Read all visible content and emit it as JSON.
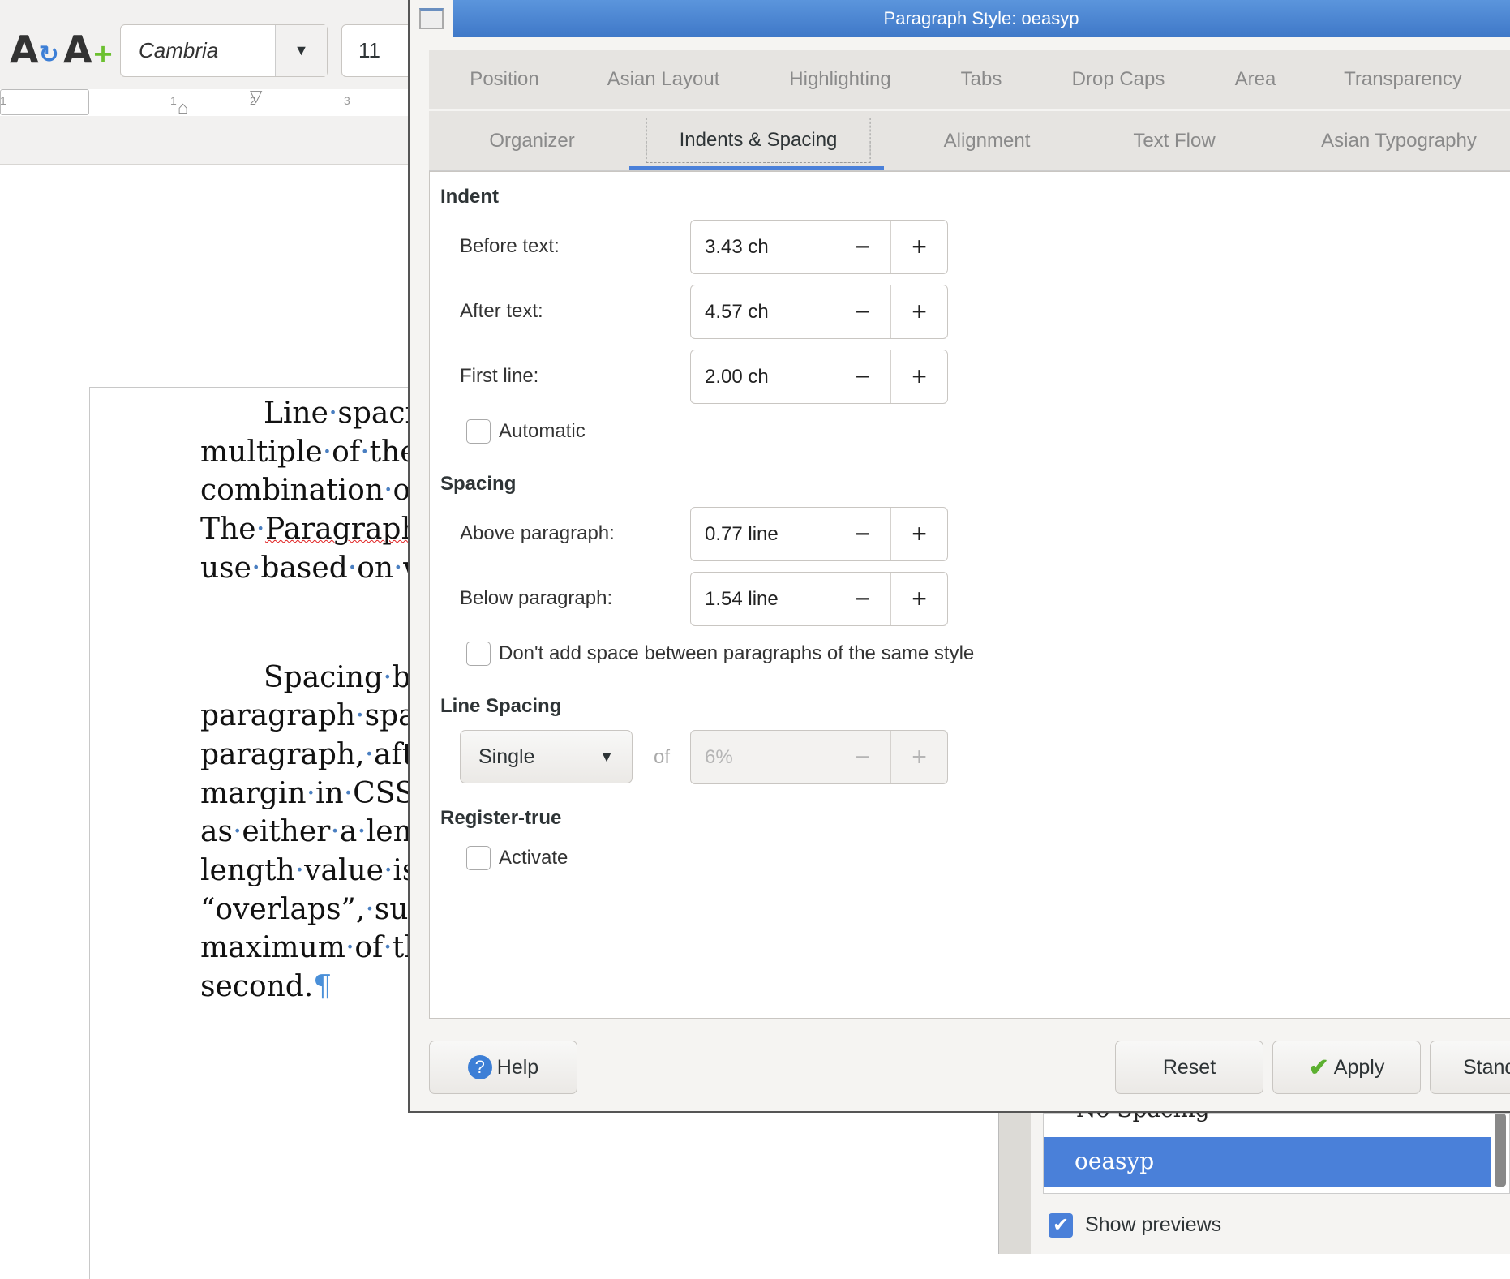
{
  "toolbar": {
    "font_name": "Cambria",
    "font_size": "11",
    "ruler_labels": [
      "1",
      "1",
      "2",
      "3"
    ]
  },
  "document": {
    "lines": [
      {
        "text": "Line·spaci",
        "indent": true
      },
      {
        "text": "multiple·of·the"
      },
      {
        "text": "combination·o"
      },
      {
        "text": "The·Paragraph",
        "wavy": "Paragraph"
      },
      {
        "text": "use·based·on·w"
      },
      {
        "text": "Spacing·be",
        "indent": true,
        "gap": true
      },
      {
        "text": "paragraph·spa"
      },
      {
        "text": "paragraph,·afte"
      },
      {
        "text": "margin·in·CSS.·"
      },
      {
        "text": "as·either·a·leng"
      },
      {
        "text": "length·value·is"
      },
      {
        "text": "“overlaps”,·suc"
      },
      {
        "text": "maximum·of·th"
      },
      {
        "text": "second.¶"
      }
    ]
  },
  "dialog": {
    "title": "Paragraph Style: oeasyp",
    "tabs_row1": [
      "Position",
      "Asian Layout",
      "Highlighting",
      "Tabs",
      "Drop Caps",
      "Area",
      "Transparency"
    ],
    "tabs_row2": [
      "Organizer",
      "Indents & Spacing",
      "Alignment",
      "Text Flow",
      "Asian Typography"
    ],
    "active_tab": "Indents & Spacing",
    "indent": {
      "heading": "Indent",
      "before_label": "Before text:",
      "before_value": "3.43 ch",
      "after_label": "After text:",
      "after_value": "4.57 ch",
      "first_label": "First line:",
      "first_value": "2.00 ch",
      "automatic_label": "Automatic",
      "automatic_checked": false
    },
    "spacing": {
      "heading": "Spacing",
      "above_label": "Above paragraph:",
      "above_value": "0.77 line",
      "below_label": "Below paragraph:",
      "below_value": "1.54 line",
      "dont_add_label": "Don't add space between paragraphs of the same style",
      "dont_add_checked": false
    },
    "line_spacing": {
      "heading": "Line Spacing",
      "mode": "Single",
      "of_label": "of",
      "value": "6%"
    },
    "register_true": {
      "heading": "Register-true",
      "activate_label": "Activate",
      "activate_checked": false
    },
    "minus": "−",
    "plus": "+",
    "buttons": {
      "help": "Help",
      "reset": "Reset",
      "apply": "Apply",
      "standard": "Stand"
    }
  },
  "styles_panel": {
    "items": [
      "No Spacing",
      "oeasyp"
    ],
    "selected": "oeasyp",
    "show_previews_label": "Show previews",
    "show_previews_checked": true
  },
  "colors": {
    "accent": "#4a80d9",
    "titlebar": "#4a84d0"
  }
}
